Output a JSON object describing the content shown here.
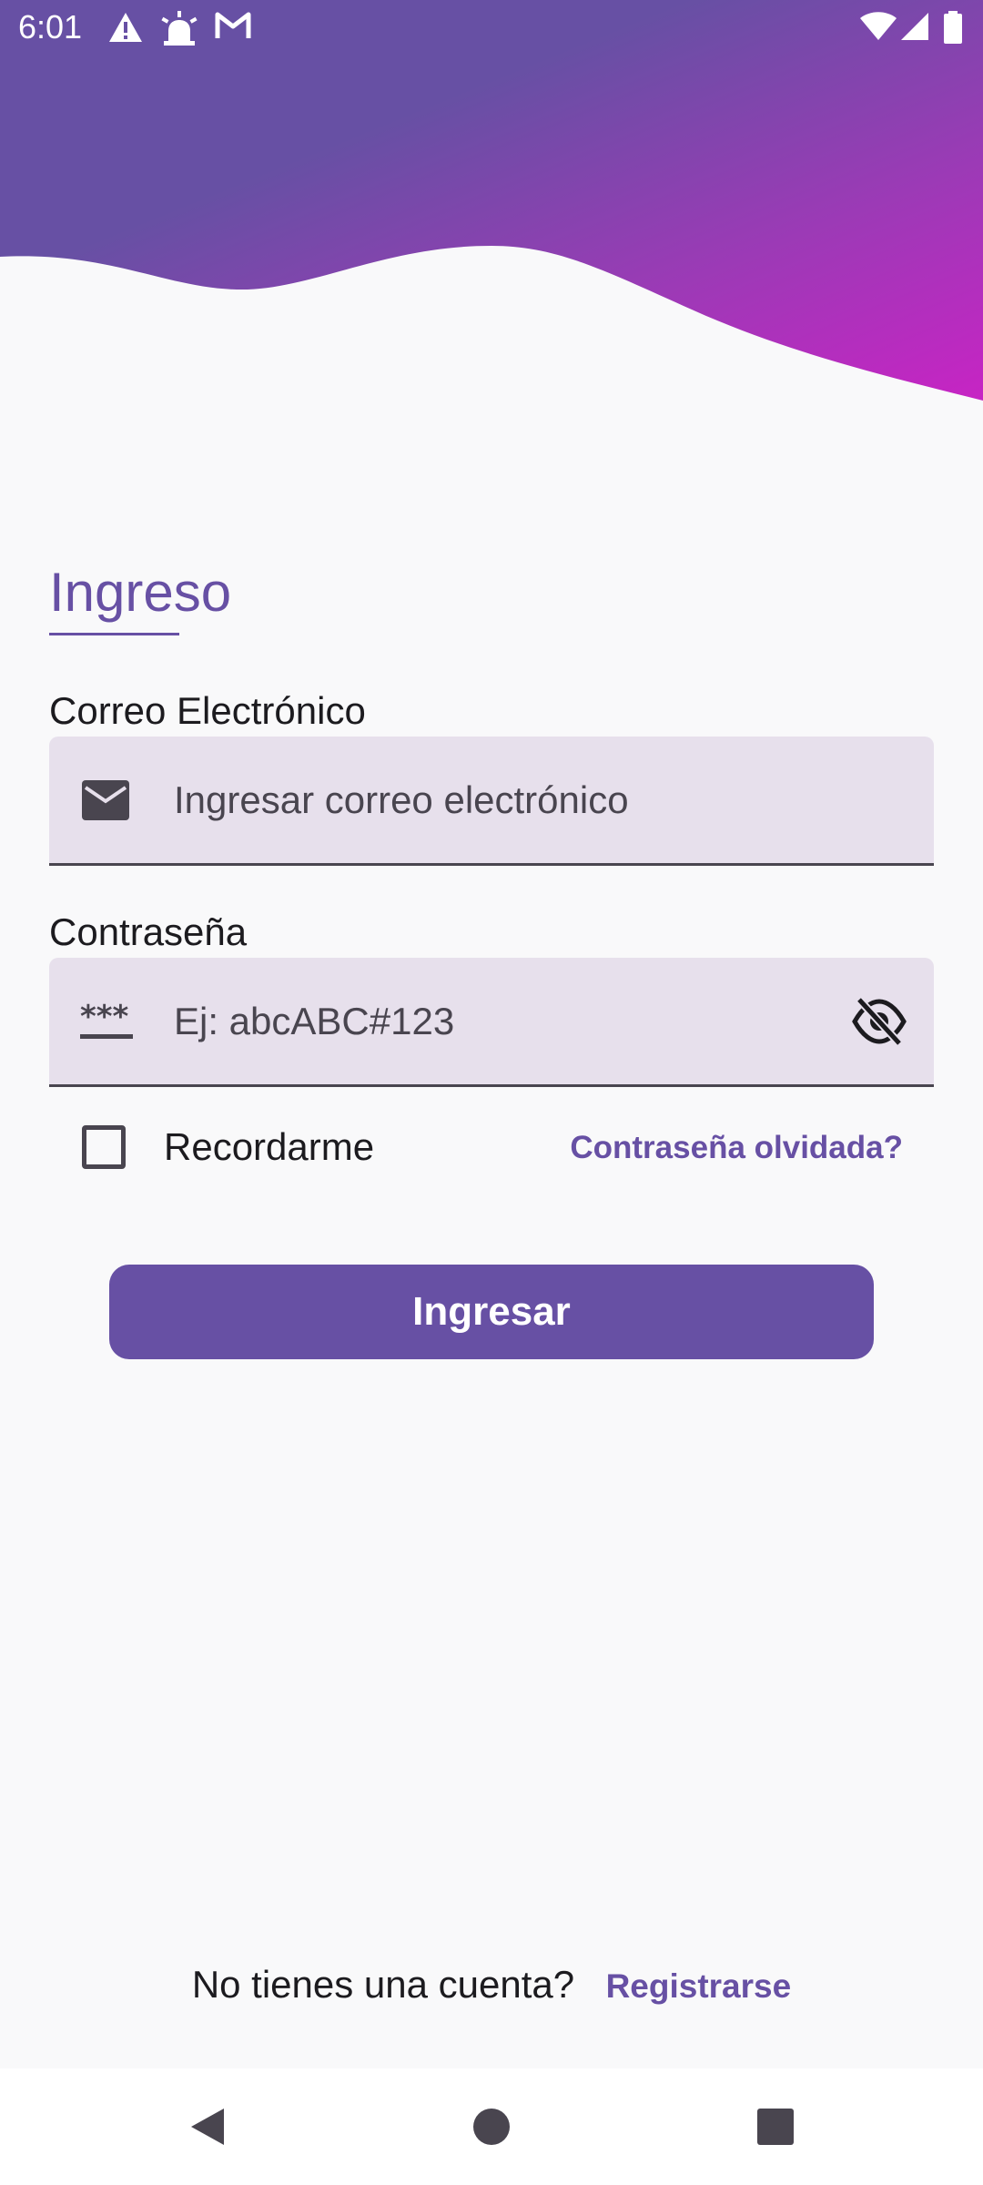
{
  "status_bar": {
    "time": "6:01",
    "left_icons": [
      "warning-icon",
      "alarm-icon",
      "gmail-icon"
    ],
    "right_icons": [
      "wifi-icon",
      "signal-icon",
      "battery-icon"
    ]
  },
  "colors": {
    "primary": "#6750a4",
    "gradient_end": "#c724c4",
    "field_background": "#e7e0ec",
    "page_background": "#f9f9fa"
  },
  "login": {
    "title": "Ingreso",
    "email": {
      "label": "Correo Electrónico",
      "placeholder": "Ingresar correo electrónico",
      "value": "",
      "icon": "email-icon"
    },
    "password": {
      "label": "Contraseña",
      "placeholder": "Ej: abcABC#123",
      "value": "",
      "icon": "password-icon",
      "toggle_icon": "visibility-off-icon"
    },
    "remember_label": "Recordarme",
    "remember_checked": false,
    "forgot_label": "Contraseña olvidada?",
    "submit_label": "Ingresar",
    "no_account_text": "No tienes una cuenta?",
    "register_label": "Registrarse"
  },
  "nav": {
    "items": [
      "back-icon",
      "home-icon",
      "recents-icon"
    ]
  }
}
